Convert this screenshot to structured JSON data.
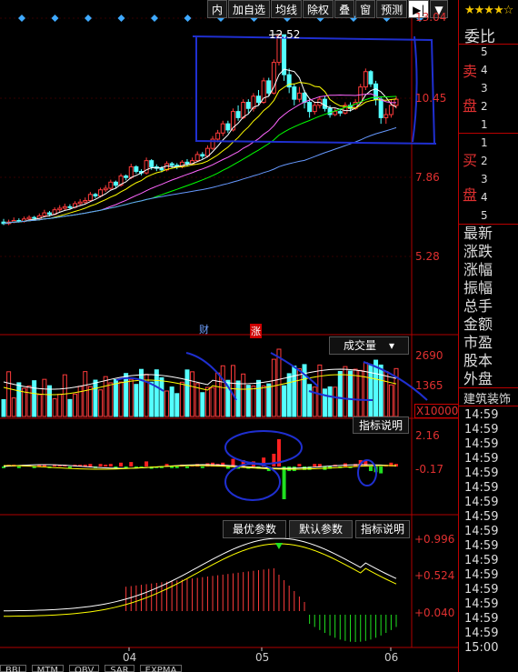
{
  "toolbar": {
    "items": [
      "内",
      "加自选",
      "均线",
      "除权",
      "叠",
      "窗",
      "预测"
    ],
    "arrow": "▶|",
    "dropdown": "▼"
  },
  "right_panel": {
    "rating_stars": "★★★★☆",
    "title": "委比",
    "sell_label": "卖盘",
    "sell_levels": [
      "5",
      "4",
      "3",
      "2",
      "1"
    ],
    "buy_label": "买盘",
    "buy_levels": [
      "1",
      "2",
      "3",
      "4",
      "5"
    ],
    "fields": [
      "最新",
      "涨跌",
      "涨幅",
      "振幅",
      "总手",
      "金额",
      "市盈",
      "股本",
      "外盘"
    ],
    "industry": "建筑装饰",
    "times": [
      "14:59",
      "14:59",
      "14:59",
      "14:59",
      "14:59",
      "14:59",
      "14:59",
      "14:59",
      "14:59",
      "14:59",
      "14:59",
      "14:59",
      "14:59",
      "14:59",
      "14:59",
      "14:59",
      "15:00"
    ]
  },
  "price_panel": {
    "y_labels": [
      "13.04",
      "10.45",
      "7.86",
      "5.28"
    ],
    "high_marker": "12.52",
    "event_tags": [
      "财",
      "涨"
    ]
  },
  "volume_panel": {
    "selector": "成交量",
    "y_labels": [
      "2690",
      "1365"
    ],
    "unit": "X10000",
    "explain": "指标说明"
  },
  "macd_panel": {
    "y_labels": [
      "2.16",
      "-0.17"
    ]
  },
  "indicator_panel": {
    "buttons": [
      "最优参数",
      "默认参数",
      "指标说明"
    ],
    "y_labels": [
      "+0.996",
      "+0.524",
      "+0.040"
    ]
  },
  "x_axis": [
    "04",
    "05",
    "06"
  ],
  "bottom_tabs": [
    "BBI",
    "MTM",
    "OBV",
    "SAR",
    "EXPMA"
  ],
  "colors": {
    "up": "#ff3b3b",
    "down": "#54ffff",
    "axis": "#b00000",
    "ma5": "#ffffff",
    "ma10": "#ffff00",
    "ma20": "#ff66ff",
    "ma30": "#00ff00",
    "ma60": "#6699ff",
    "annotation": "#1f2fd0"
  },
  "chart_data": {
    "type": "candlestick",
    "ylim": [
      5.28,
      13.04
    ],
    "yticks": [
      13.04,
      10.45,
      7.86,
      5.28
    ],
    "annotated_high": 12.52,
    "x_ticks": [
      "04",
      "05",
      "06"
    ],
    "series_note": "approximate daily OHLC read from the chart",
    "candles": [
      [
        6.4,
        6.35,
        6.5,
        6.3
      ],
      [
        6.35,
        6.4,
        6.48,
        6.3
      ],
      [
        6.4,
        6.45,
        6.55,
        6.36
      ],
      [
        6.45,
        6.42,
        6.52,
        6.38
      ],
      [
        6.42,
        6.5,
        6.58,
        6.38
      ],
      [
        6.5,
        6.55,
        6.62,
        6.45
      ],
      [
        6.55,
        6.52,
        6.6,
        6.46
      ],
      [
        6.52,
        6.6,
        6.68,
        6.48
      ],
      [
        6.6,
        6.7,
        6.8,
        6.56
      ],
      [
        6.7,
        6.65,
        6.76,
        6.58
      ],
      [
        6.65,
        6.8,
        6.88,
        6.62
      ],
      [
        6.8,
        6.85,
        6.95,
        6.72
      ],
      [
        6.85,
        6.9,
        7.0,
        6.78
      ],
      [
        6.9,
        6.88,
        6.98,
        6.8
      ],
      [
        6.88,
        7.0,
        7.08,
        6.84
      ],
      [
        7.0,
        7.05,
        7.15,
        6.95
      ],
      [
        7.05,
        7.1,
        7.2,
        7.0
      ],
      [
        7.1,
        7.3,
        7.38,
        7.06
      ],
      [
        7.3,
        7.25,
        7.35,
        7.18
      ],
      [
        7.25,
        7.45,
        7.52,
        7.2
      ],
      [
        7.45,
        7.5,
        7.6,
        7.38
      ],
      [
        7.5,
        7.7,
        7.78,
        7.45
      ],
      [
        7.7,
        7.6,
        7.75,
        7.52
      ],
      [
        7.6,
        7.9,
        7.98,
        7.55
      ],
      [
        7.9,
        7.85,
        7.95,
        7.76
      ],
      [
        7.85,
        8.2,
        8.3,
        7.8
      ],
      [
        8.2,
        8.05,
        8.25,
        7.98
      ],
      [
        8.05,
        8.0,
        8.12,
        7.92
      ],
      [
        8.0,
        8.4,
        8.5,
        7.95
      ],
      [
        8.4,
        8.2,
        8.45,
        8.1
      ],
      [
        8.2,
        8.15,
        8.28,
        8.06
      ],
      [
        8.15,
        8.1,
        8.22,
        8.02
      ],
      [
        8.1,
        8.3,
        8.38,
        8.05
      ],
      [
        8.3,
        8.25,
        8.36,
        8.16
      ],
      [
        8.25,
        8.2,
        8.32,
        8.12
      ],
      [
        8.2,
        8.35,
        8.42,
        8.15
      ],
      [
        8.35,
        8.3,
        8.45,
        8.22
      ],
      [
        8.3,
        8.4,
        8.5,
        8.25
      ],
      [
        8.4,
        8.6,
        8.7,
        8.35
      ],
      [
        8.6,
        8.55,
        8.68,
        8.46
      ],
      [
        8.55,
        8.8,
        8.9,
        8.5
      ],
      [
        8.8,
        9.1,
        9.2,
        8.75
      ],
      [
        9.1,
        9.3,
        9.4,
        9.0
      ],
      [
        9.3,
        9.6,
        9.7,
        9.2
      ],
      [
        9.6,
        9.4,
        9.7,
        9.3
      ],
      [
        9.4,
        10.0,
        10.1,
        9.35
      ],
      [
        10.0,
        9.8,
        10.2,
        9.7
      ],
      [
        9.8,
        10.3,
        10.4,
        9.75
      ],
      [
        10.3,
        10.1,
        10.4,
        9.95
      ],
      [
        10.1,
        10.5,
        10.6,
        10.0
      ],
      [
        10.5,
        10.3,
        10.7,
        10.2
      ],
      [
        10.3,
        11.0,
        11.1,
        10.25
      ],
      [
        11.0,
        10.6,
        11.1,
        10.5
      ],
      [
        10.6,
        11.6,
        11.7,
        10.55
      ],
      [
        11.6,
        12.5,
        12.52,
        11.5
      ],
      [
        12.5,
        11.2,
        12.4,
        11.0
      ],
      [
        11.2,
        10.8,
        11.4,
        10.6
      ],
      [
        10.8,
        10.4,
        10.9,
        10.2
      ],
      [
        10.4,
        10.6,
        10.8,
        10.3
      ],
      [
        10.6,
        10.3,
        10.7,
        10.1
      ],
      [
        10.3,
        10.0,
        10.4,
        9.8
      ],
      [
        10.0,
        10.2,
        10.3,
        9.9
      ],
      [
        10.2,
        10.4,
        10.5,
        10.1
      ],
      [
        10.4,
        10.1,
        10.5,
        10.0
      ],
      [
        10.1,
        9.9,
        10.2,
        9.8
      ],
      [
        9.9,
        10.0,
        10.1,
        9.85
      ],
      [
        10.0,
        9.95,
        10.1,
        9.85
      ],
      [
        9.95,
        10.2,
        10.3,
        9.9
      ],
      [
        10.2,
        10.1,
        10.3,
        10.0
      ],
      [
        10.1,
        10.3,
        10.4,
        10.05
      ],
      [
        10.3,
        10.8,
        10.9,
        10.25
      ],
      [
        10.8,
        11.3,
        11.4,
        10.7
      ],
      [
        11.3,
        10.9,
        11.35,
        10.8
      ],
      [
        10.9,
        10.4,
        11.0,
        10.2
      ],
      [
        10.4,
        9.8,
        10.5,
        9.6
      ],
      [
        9.8,
        9.9,
        10.1,
        9.6
      ],
      [
        9.9,
        10.2,
        10.4,
        9.8
      ],
      [
        10.2,
        10.4,
        10.5,
        10.1
      ]
    ]
  }
}
